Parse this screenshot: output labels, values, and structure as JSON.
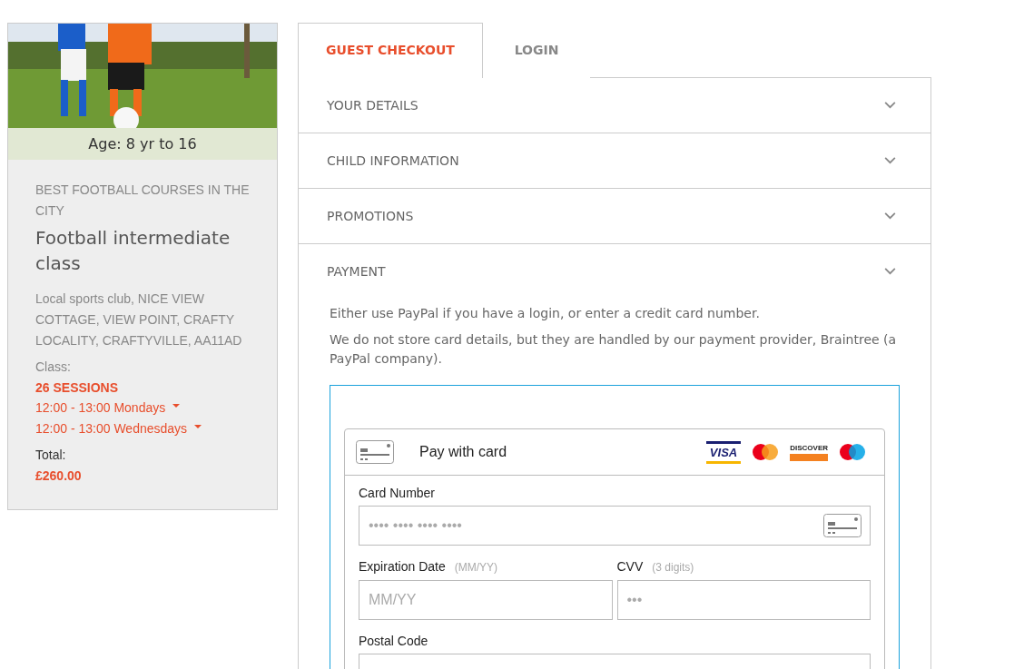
{
  "course_card": {
    "age": "Age: 8 yr to 16",
    "category": "BEST FOOTBALL COURSES IN THE CITY",
    "title": "Football intermediate class",
    "address": "Local sports club, NICE VIEW COTTAGE, VIEW POINT, CRAFTY LOCALITY, CRAFTYVILLE, AA11AD",
    "class_label": "Class:",
    "sessions": "26 SESSIONS",
    "schedule": [
      {
        "label": "12:00 - 13:00 Mondays"
      },
      {
        "label": "12:00 - 13:00 Wednesdays"
      }
    ],
    "total_label": "Total:",
    "total": "£260.00"
  },
  "tabs": [
    {
      "label": "GUEST CHECKOUT",
      "selected": true
    },
    {
      "label": "LOGIN",
      "selected": false
    }
  ],
  "sections": [
    {
      "title": "YOUR DETAILS"
    },
    {
      "title": "CHILD INFORMATION"
    },
    {
      "title": "PROMOTIONS"
    },
    {
      "title": "PAYMENT"
    }
  ],
  "payment": {
    "intro": [
      "Either use PayPal if you have a login, or enter a credit card number.",
      "We do not store card details, but they are handled by our payment provider, Braintree (a PayPal company)."
    ],
    "card_form": {
      "title": "Pay with card",
      "card_brands": [
        {
          "kind": "visa",
          "label": "VISA"
        },
        {
          "kind": "mastercard"
        },
        {
          "kind": "discover",
          "label": "DISCOVER"
        },
        {
          "kind": "maestro"
        }
      ],
      "field_rows": [
        [
          {
            "label": "Card Number",
            "placeholder": "•••• •••• •••• ••••",
            "card_icon": true
          }
        ],
        [
          {
            "label": "Expiration Date",
            "hint": "(MM/YY)",
            "placeholder": "MM/YY"
          },
          {
            "label": "CVV",
            "hint": "(3 digits)",
            "placeholder": "•••"
          }
        ],
        [
          {
            "label": "Postal Code"
          }
        ]
      ]
    }
  }
}
